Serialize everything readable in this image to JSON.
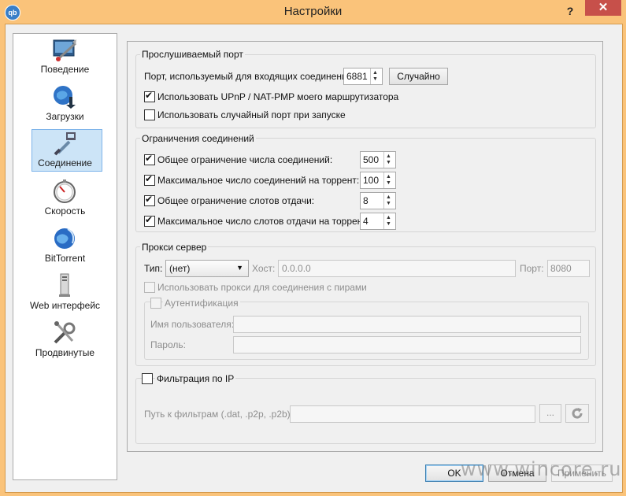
{
  "window": {
    "title": "Настройки",
    "app_icon_text": "qb",
    "help_label": "?",
    "close_label": "✕"
  },
  "sidebar": {
    "items": [
      {
        "label": "Поведение",
        "icon": "behavior-icon",
        "selected": false
      },
      {
        "label": "Загрузки",
        "icon": "downloads-icon",
        "selected": false
      },
      {
        "label": "Соединение",
        "icon": "connection-icon",
        "selected": true
      },
      {
        "label": "Скорость",
        "icon": "speed-icon",
        "selected": false
      },
      {
        "label": "BitTorrent",
        "icon": "bittorrent-icon",
        "selected": false
      },
      {
        "label": "Web интерфейс",
        "icon": "web-interface-icon",
        "selected": false
      },
      {
        "label": "Продвинутые",
        "icon": "advanced-icon",
        "selected": false
      }
    ]
  },
  "listening_port": {
    "title": "Прослушиваемый порт",
    "port_label": "Порт, используемый для входящих соединений:",
    "port_value": "6881",
    "random_button": "Случайно",
    "upnp_label": "Использовать UPnP / NAT-PMP моего маршрутизатора",
    "upnp_checked": true,
    "random_on_start_label": "Использовать случайный порт при запуске",
    "random_on_start_checked": false
  },
  "connection_limits": {
    "title": "Ограничения соединений",
    "rows": [
      {
        "label": "Общее ограничение числа соединений:",
        "value": "500",
        "checked": true
      },
      {
        "label": "Максимальное число соединений на торрент:",
        "value": "100",
        "checked": true
      },
      {
        "label": "Общее ограничение слотов отдачи:",
        "value": "8",
        "checked": true
      },
      {
        "label": "Максимальное число слотов отдачи на торрент:",
        "value": "4",
        "checked": true
      }
    ]
  },
  "proxy": {
    "title": "Прокси сервер",
    "type_label": "Тип:",
    "type_value": "(нет)",
    "host_label": "Хост:",
    "host_value": "0.0.0.0",
    "port_label": "Порт:",
    "port_value": "8080",
    "peers_label": "Использовать прокси для соединения с пирами",
    "auth_label": "Аутентификация",
    "username_label": "Имя пользователя:",
    "password_label": "Пароль:"
  },
  "ip_filter": {
    "title": "Фильтрация по IP",
    "path_label": "Путь к фильтрам (.dat, .p2p, .p2b):",
    "browse_label": "...",
    "reload_icon": "reload-icon"
  },
  "footer": {
    "ok": "OK",
    "cancel": "Отмена",
    "apply": "Применить"
  },
  "watermark": "www.wincore.ru",
  "colors": {
    "title_bar": "#fac37a",
    "close_button": "#c7504a",
    "selection": "#cce4f7"
  }
}
